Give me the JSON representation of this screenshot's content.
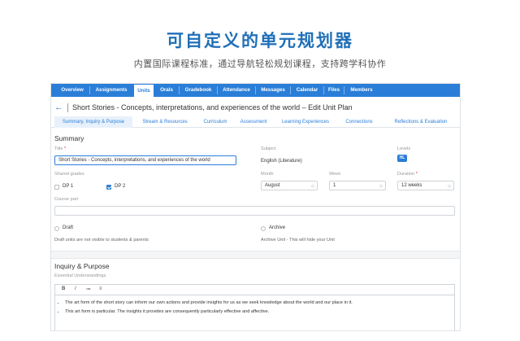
{
  "hero": {
    "title": "可自定义的单元规划器",
    "subtitle": "内置国际课程标准，通过导航轻松规划课程，支持跨学科协作"
  },
  "nav": {
    "tabs": [
      "Overview",
      "Assignments",
      "Units",
      "Orals",
      "Gradebook",
      "Attendance",
      "Messages",
      "Calendar",
      "Files",
      "Members"
    ],
    "active": "Units"
  },
  "page": {
    "title": "Short Stories - Concepts, interpretations, and experiences of the world – Edit Unit Plan"
  },
  "subtabs": {
    "items": [
      "Summary, Inquiry & Purpose",
      "Stream & Resources",
      "Curriculum",
      "Assessment",
      "Learning Experiences",
      "Connections",
      "Reflections & Evaluation"
    ],
    "active": "Summary, Inquiry & Purpose"
  },
  "summary": {
    "heading": "Summary",
    "title_label": "Title",
    "title_value": "Short Stories - Concepts, interpretations, and experiences of the world",
    "subject_label": "Subject",
    "subject_value": "English (Literature)",
    "levels_label": "Levels",
    "levels_value": "HL",
    "shared_grades_label": "Shared grades",
    "grades": [
      {
        "label": "DP 1",
        "checked": false
      },
      {
        "label": "DP 2",
        "checked": true
      }
    ],
    "month_label": "Month",
    "month_value": "August",
    "week_label": "Week",
    "week_value": "1",
    "duration_label": "Duration",
    "duration_value": "12 weeks",
    "course_part_label": "Course part",
    "course_part_value": "",
    "draft_label": "Draft",
    "draft_note": "Draft units are not visible to students & parents",
    "archive_label": "Archive",
    "archive_note": "Archive Unit - This will hide your Unit"
  },
  "inquiry": {
    "heading": "Inquiry & Purpose",
    "sub_label": "Essential Understandings",
    "toolbar": [
      "B",
      "I",
      "≔",
      "≡"
    ],
    "bullets": [
      "The art form of the short story can inform our own actions and provide insights for us as we seek knowledge about the world and our place in it.",
      "This art form is particular. The insights it provides are consequently particularly effective and affective."
    ]
  },
  "colors": {
    "accent": "#2a7ed8",
    "hero_title": "#1f6fb8"
  }
}
